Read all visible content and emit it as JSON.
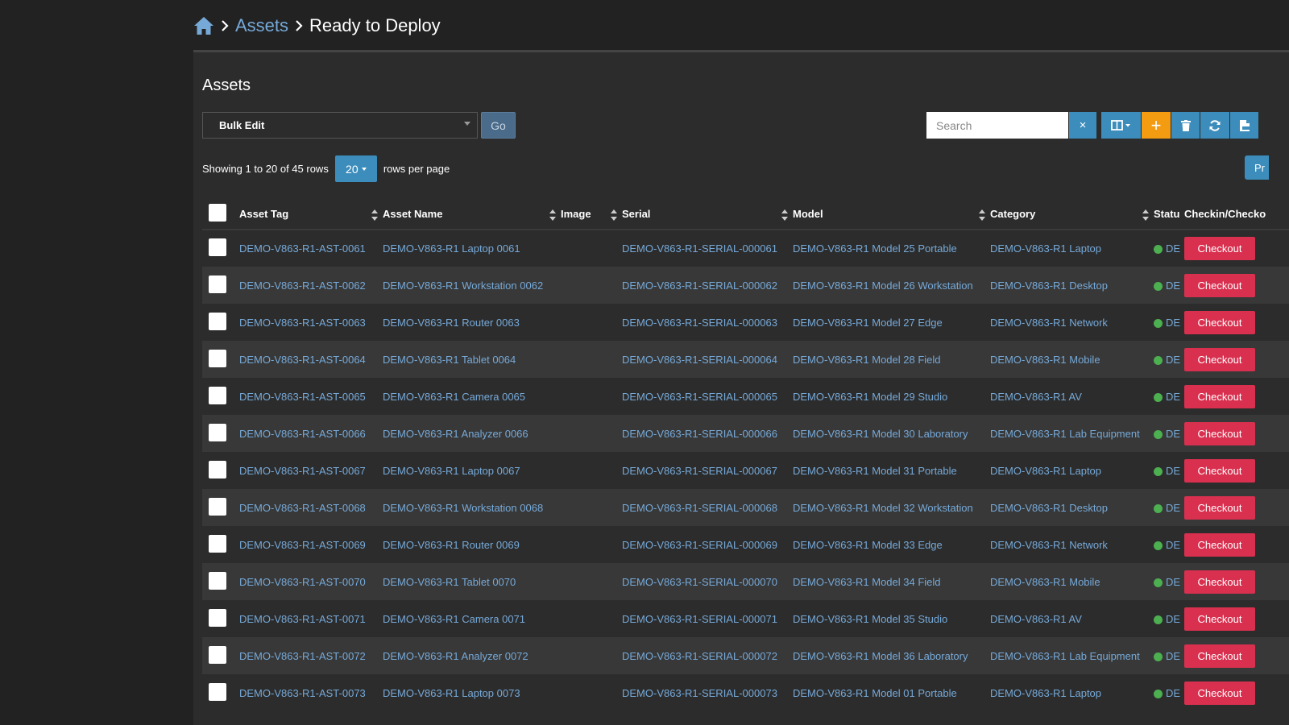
{
  "breadcrumb": {
    "home_icon": "home-icon",
    "parent": "Assets",
    "current": "Ready to Deploy"
  },
  "box": {
    "title": "Assets"
  },
  "toolbar": {
    "bulk_select_value": "Bulk Edit",
    "go_label": "Go",
    "search_placeholder": "Search",
    "clear_icon": "×",
    "add_icon": "+"
  },
  "pagination": {
    "showing": "Showing 1 to 20 of 45 rows",
    "page_size": "20",
    "rows_per_page": "rows per page",
    "extra_button": "Pr"
  },
  "columns": {
    "asset_tag": "Asset Tag",
    "asset_name": "Asset Name",
    "image": "Image",
    "serial": "Serial",
    "model": "Model",
    "category": "Category",
    "status": "Statu",
    "checkin": "Checkin/Checko"
  },
  "status_label": "DE",
  "checkout_label": "Checkout",
  "colors": {
    "accent": "#3c8dbc",
    "add": "#f39c12",
    "checkout": "#d9304f",
    "link": "#76a9d8",
    "status_ready": "#4caf50"
  },
  "rows": [
    {
      "tag": "DEMO-V863-R1-AST-0061",
      "name": "DEMO-V863-R1 Laptop 0061",
      "serial": "DEMO-V863-R1-SERIAL-000061",
      "model": "DEMO-V863-R1 Model 25 Portable",
      "category": "DEMO-V863-R1 Laptop"
    },
    {
      "tag": "DEMO-V863-R1-AST-0062",
      "name": "DEMO-V863-R1 Workstation 0062",
      "serial": "DEMO-V863-R1-SERIAL-000062",
      "model": "DEMO-V863-R1 Model 26 Workstation",
      "category": "DEMO-V863-R1 Desktop"
    },
    {
      "tag": "DEMO-V863-R1-AST-0063",
      "name": "DEMO-V863-R1 Router 0063",
      "serial": "DEMO-V863-R1-SERIAL-000063",
      "model": "DEMO-V863-R1 Model 27 Edge",
      "category": "DEMO-V863-R1 Network"
    },
    {
      "tag": "DEMO-V863-R1-AST-0064",
      "name": "DEMO-V863-R1 Tablet 0064",
      "serial": "DEMO-V863-R1-SERIAL-000064",
      "model": "DEMO-V863-R1 Model 28 Field",
      "category": "DEMO-V863-R1 Mobile"
    },
    {
      "tag": "DEMO-V863-R1-AST-0065",
      "name": "DEMO-V863-R1 Camera 0065",
      "serial": "DEMO-V863-R1-SERIAL-000065",
      "model": "DEMO-V863-R1 Model 29 Studio",
      "category": "DEMO-V863-R1 AV"
    },
    {
      "tag": "DEMO-V863-R1-AST-0066",
      "name": "DEMO-V863-R1 Analyzer 0066",
      "serial": "DEMO-V863-R1-SERIAL-000066",
      "model": "DEMO-V863-R1 Model 30 Laboratory",
      "category": "DEMO-V863-R1 Lab Equipment"
    },
    {
      "tag": "DEMO-V863-R1-AST-0067",
      "name": "DEMO-V863-R1 Laptop 0067",
      "serial": "DEMO-V863-R1-SERIAL-000067",
      "model": "DEMO-V863-R1 Model 31 Portable",
      "category": "DEMO-V863-R1 Laptop"
    },
    {
      "tag": "DEMO-V863-R1-AST-0068",
      "name": "DEMO-V863-R1 Workstation 0068",
      "serial": "DEMO-V863-R1-SERIAL-000068",
      "model": "DEMO-V863-R1 Model 32 Workstation",
      "category": "DEMO-V863-R1 Desktop"
    },
    {
      "tag": "DEMO-V863-R1-AST-0069",
      "name": "DEMO-V863-R1 Router 0069",
      "serial": "DEMO-V863-R1-SERIAL-000069",
      "model": "DEMO-V863-R1 Model 33 Edge",
      "category": "DEMO-V863-R1 Network"
    },
    {
      "tag": "DEMO-V863-R1-AST-0070",
      "name": "DEMO-V863-R1 Tablet 0070",
      "serial": "DEMO-V863-R1-SERIAL-000070",
      "model": "DEMO-V863-R1 Model 34 Field",
      "category": "DEMO-V863-R1 Mobile"
    },
    {
      "tag": "DEMO-V863-R1-AST-0071",
      "name": "DEMO-V863-R1 Camera 0071",
      "serial": "DEMO-V863-R1-SERIAL-000071",
      "model": "DEMO-V863-R1 Model 35 Studio",
      "category": "DEMO-V863-R1 AV"
    },
    {
      "tag": "DEMO-V863-R1-AST-0072",
      "name": "DEMO-V863-R1 Analyzer 0072",
      "serial": "DEMO-V863-R1-SERIAL-000072",
      "model": "DEMO-V863-R1 Model 36 Laboratory",
      "category": "DEMO-V863-R1 Lab Equipment"
    },
    {
      "tag": "DEMO-V863-R1-AST-0073",
      "name": "DEMO-V863-R1 Laptop 0073",
      "serial": "DEMO-V863-R1-SERIAL-000073",
      "model": "DEMO-V863-R1 Model 01 Portable",
      "category": "DEMO-V863-R1 Laptop"
    }
  ]
}
